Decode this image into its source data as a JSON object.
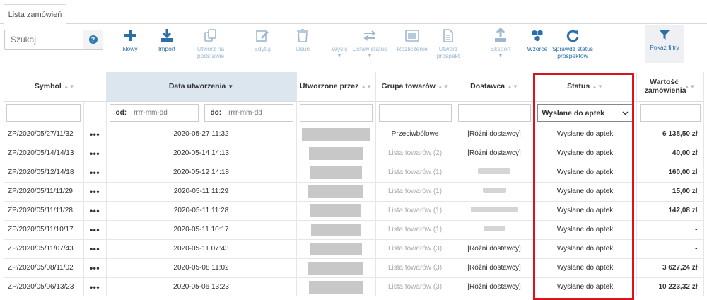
{
  "tabs": [
    {
      "label": "Lista zamówień"
    }
  ],
  "search": {
    "placeholder": "Szukaj"
  },
  "toolbar": [
    {
      "id": "new",
      "label": "Nowy",
      "icon": "plus-icon",
      "enabled": true
    },
    {
      "id": "import",
      "label": "Import",
      "icon": "download-icon",
      "enabled": true
    },
    {
      "id": "create-base",
      "label": "Utwórz na podstawie",
      "icon": "copy-icon",
      "enabled": false
    },
    {
      "id": "edit",
      "label": "Edytuj",
      "icon": "pencil-icon",
      "enabled": false
    },
    {
      "id": "delete",
      "label": "Usuń",
      "icon": "trash-icon",
      "enabled": false
    },
    {
      "id": "send",
      "label": "Wyślij",
      "icon": "share-icon",
      "enabled": false
    },
    {
      "id": "set-status",
      "label": "Ustaw status",
      "icon": "swap-icon",
      "enabled": false
    },
    {
      "id": "settle",
      "label": "Rozliczenie",
      "icon": "list-icon",
      "enabled": false
    },
    {
      "id": "create-prospect",
      "label": "Utwórz prospekt",
      "icon": "document-icon",
      "enabled": false
    },
    {
      "id": "export",
      "label": "Eksport",
      "icon": "upload-icon",
      "enabled": false
    },
    {
      "id": "templates",
      "label": "Wzorce",
      "icon": "cubes-icon",
      "enabled": true
    },
    {
      "id": "check-status",
      "label": "Sprawdź status prospektów",
      "icon": "refresh-icon",
      "enabled": true
    }
  ],
  "filters_button": {
    "label": "Pokaż filtry"
  },
  "columns": {
    "symbol": "Symbol",
    "date": "Data utworzenia",
    "created_by": "Utworzone przez",
    "group": "Grupa towarów",
    "supplier": "Dostawca",
    "status": "Status",
    "value": "Wartość zamówienia"
  },
  "date_filter": {
    "from_label": "od:",
    "to_label": "do:",
    "placeholder": "rrrr-mm-dd"
  },
  "status_filter": {
    "selected": "Wysłane do aptek"
  },
  "rows": [
    {
      "symbol": "ZP/2020/05/27/11/32",
      "date": "2020-05-27 11:32",
      "group": "Przeciwbólowe",
      "group_muted": false,
      "supplier": "[Różni dostawcy]",
      "status": "Wysłane do aptek",
      "value": "6 138,50 zł"
    },
    {
      "symbol": "ZP/2020/05/14/14/13",
      "date": "2020-05-14 14:13",
      "group": "Lista towarów (2)",
      "group_muted": true,
      "supplier": "[Różni dostawcy]",
      "status": "Wysłane do aptek",
      "value": "40,00 zł"
    },
    {
      "symbol": "ZP/2020/05/12/14/18",
      "date": "2020-05-12 14:18",
      "group": "Lista towarów (1)",
      "group_muted": true,
      "supplier": "",
      "status": "Wysłane do aptek",
      "value": "160,00 zł"
    },
    {
      "symbol": "ZP/2020/05/11/11/29",
      "date": "2020-05-11 11:29",
      "group": "Lista towarów (1)",
      "group_muted": true,
      "supplier": "",
      "status": "Wysłane do aptek",
      "value": "15,00 zł"
    },
    {
      "symbol": "ZP/2020/05/11/11/28",
      "date": "2020-05-11 11:28",
      "group": "Lista towarów (1)",
      "group_muted": true,
      "supplier": "",
      "status": "Wysłane do aptek",
      "value": "142,08 zł"
    },
    {
      "symbol": "ZP/2020/05/11/10/17",
      "date": "2020-05-11 10:17",
      "group": "Lista towarów (1)",
      "group_muted": true,
      "supplier": "",
      "status": "Wysłane do aptek",
      "value": "-"
    },
    {
      "symbol": "ZP/2020/05/11/07/43",
      "date": "2020-05-11 07:43",
      "group": "Lista towarów (3)",
      "group_muted": true,
      "supplier": "[Różni dostawcy]",
      "status": "Wysłane do aptek",
      "value": "-"
    },
    {
      "symbol": "ZP/2020/05/08/11/02",
      "date": "2020-05-08 11:02",
      "group": "Lista towarów (3)",
      "group_muted": true,
      "supplier": "[Różni dostawcy]",
      "status": "Wysłane do aptek",
      "value": "3 627,24 zł"
    },
    {
      "symbol": "ZP/2020/05/06/13/23",
      "date": "2020-05-06 13:23",
      "group": "Lista towarów (3)",
      "group_muted": true,
      "supplier": "[Różni dostawcy]",
      "status": "Wysłane do aptek",
      "value": "10 223,32 zł"
    }
  ],
  "colors": {
    "accent": "#2c6fa8",
    "highlight": "#d9141b",
    "sorted_header": "#dbe6ef"
  }
}
